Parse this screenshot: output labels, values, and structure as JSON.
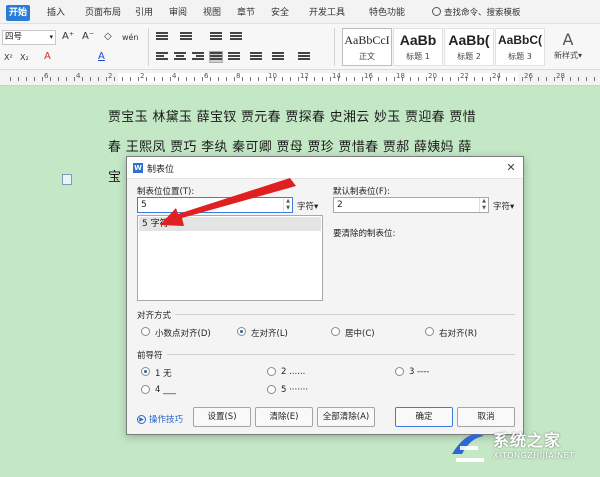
{
  "tabs": [
    "开始",
    "插入",
    "页面布局",
    "引用",
    "审阅",
    "视图",
    "章节",
    "安全",
    "开发工具",
    "特色功能"
  ],
  "search_label": "查找命令、搜索模板",
  "toolbar": {
    "font_size_value": "四号",
    "font_buttons": [
      "A⁺",
      "A⁻",
      "◇",
      "wén"
    ],
    "format_buttons": [
      "X²",
      "X₂",
      "A",
      "A"
    ],
    "styles": [
      {
        "sample": "AaBbCcI",
        "name": "正文"
      },
      {
        "sample": "AaBb",
        "name": "标题 1"
      },
      {
        "sample": "AaBb(",
        "name": "标题 2"
      },
      {
        "sample": "AaBbC(",
        "name": "标题 3"
      }
    ],
    "new_style_label": "新样式▾"
  },
  "ruler": {
    "numbers": [
      "6",
      "4",
      "2",
      "2",
      "4",
      "6",
      "8",
      "10",
      "12",
      "14",
      "16",
      "18",
      "20",
      "22",
      "24",
      "26",
      "28"
    ]
  },
  "document": {
    "lines": [
      "贾宝玉 林黛玉 薛宝钗 贾元春 贾探春 史湘云 妙玉 贾迎春 贾惜",
      "春 王熙凤 贾巧 李纨 秦可卿 贾母 贾珍 贾惜春 贾郝 薛姨妈 薛",
      "宝"
    ]
  },
  "dialog": {
    "title": "制表位",
    "logo": "W",
    "tab_position_label": "制表位位置(T):",
    "tab_position_value": "5",
    "tab_position_unit": "字符▾",
    "tab_list": [
      "5 字符"
    ],
    "default_tab_label": "默认制表位(F):",
    "default_tab_value": "2",
    "default_tab_unit": "字符▾",
    "clear_label": "要清除的制表位:",
    "alignment_label": "对齐方式",
    "alignment_options": [
      "小数点对齐(D)",
      "左对齐(L)",
      "居中(C)",
      "右对齐(R)"
    ],
    "alignment_selected": "左对齐(L)",
    "leader_label": "前导符",
    "leader_options": [
      "1 无",
      "2 ......",
      "3 ----",
      "4 ___",
      "5 ·······"
    ],
    "leader_selected": "1 无",
    "tips_label": "操作技巧",
    "buttons": {
      "set": "设置(S)",
      "clear": "清除(E)",
      "clear_all": "全部清除(A)",
      "ok": "确定",
      "cancel": "取消"
    }
  },
  "watermark": {
    "name": "系统之家",
    "url": "XITONGZHIJIA.NET"
  },
  "colors": {
    "accent": "#2b7bd8",
    "doc_bg": "#c4e8c6",
    "arrow": "#e02020"
  }
}
